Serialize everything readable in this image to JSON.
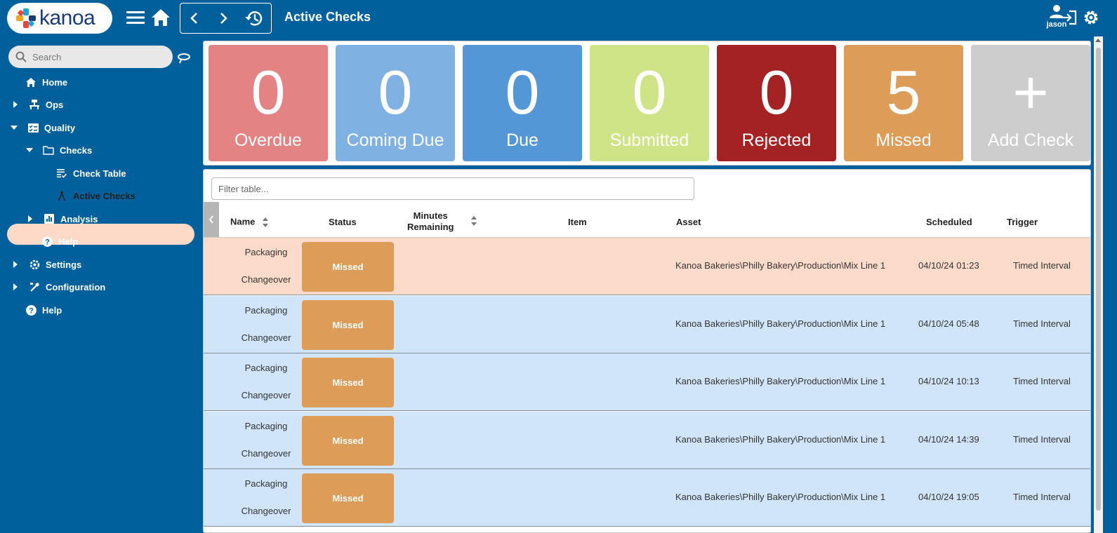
{
  "header": {
    "logo_text": "kanoa",
    "page_title": "Active Checks",
    "user_name": "jason"
  },
  "sidebar": {
    "search_placeholder": "Search",
    "items": [
      {
        "label": "Home",
        "icon": "home-icon"
      },
      {
        "label": "Ops",
        "icon": "ops-icon"
      },
      {
        "label": "Quality",
        "icon": "quality-icon"
      },
      {
        "label": "Checks",
        "icon": "folder-icon"
      },
      {
        "label": "Check Table",
        "icon": "list-check-icon"
      },
      {
        "label": "Active Checks",
        "icon": "compass-icon"
      },
      {
        "label": "Analysis",
        "icon": "analysis-icon"
      },
      {
        "label": "Help",
        "icon": "help-icon"
      },
      {
        "label": "Settings",
        "icon": "gear-icon"
      },
      {
        "label": "Configuration",
        "icon": "tools-icon"
      },
      {
        "label": "Help",
        "icon": "help-icon"
      }
    ]
  },
  "tiles": [
    {
      "count": "0",
      "label": "Overdue",
      "color": "#e38383"
    },
    {
      "count": "0",
      "label": "Coming Due",
      "color": "#7fb1e3"
    },
    {
      "count": "0",
      "label": "Due",
      "color": "#5497d7"
    },
    {
      "count": "0",
      "label": "Submitted",
      "color": "#cfe486"
    },
    {
      "count": "0",
      "label": "Rejected",
      "color": "#a52224"
    },
    {
      "count": "5",
      "label": "Missed",
      "color": "#dd9c58"
    },
    {
      "count": "+",
      "label": "Add Check",
      "color": "#cdcdcd"
    }
  ],
  "table": {
    "filter_placeholder": "Filter table...",
    "columns": {
      "name": "Name",
      "status": "Status",
      "minutes_1": "Minutes",
      "minutes_2": "Remaining",
      "item": "Item",
      "asset": "Asset",
      "scheduled": "Scheduled",
      "trigger": "Trigger"
    },
    "rows": [
      {
        "name_1": "Packaging",
        "name_2": "Changeover",
        "status": "Missed",
        "minutes": "",
        "item": "",
        "asset": "Kanoa Bakeries\\Philly Bakery\\Production\\Mix Line 1",
        "scheduled": "04/10/24 01:23",
        "trigger": "Timed Interval"
      },
      {
        "name_1": "Packaging",
        "name_2": "Changeover",
        "status": "Missed",
        "minutes": "",
        "item": "",
        "asset": "Kanoa Bakeries\\Philly Bakery\\Production\\Mix Line 1",
        "scheduled": "04/10/24 05:48",
        "trigger": "Timed Interval"
      },
      {
        "name_1": "Packaging",
        "name_2": "Changeover",
        "status": "Missed",
        "minutes": "",
        "item": "",
        "asset": "Kanoa Bakeries\\Philly Bakery\\Production\\Mix Line 1",
        "scheduled": "04/10/24 10:13",
        "trigger": "Timed Interval"
      },
      {
        "name_1": "Packaging",
        "name_2": "Changeover",
        "status": "Missed",
        "minutes": "",
        "item": "",
        "asset": "Kanoa Bakeries\\Philly Bakery\\Production\\Mix Line 1",
        "scheduled": "04/10/24 14:39",
        "trigger": "Timed Interval"
      },
      {
        "name_1": "Packaging",
        "name_2": "Changeover",
        "status": "Missed",
        "minutes": "",
        "item": "",
        "asset": "Kanoa Bakeries\\Philly Bakery\\Production\\Mix Line 1",
        "scheduled": "04/10/24 19:05",
        "trigger": "Timed Interval"
      }
    ]
  },
  "colors": {
    "brand": "#00609c",
    "active_nav": "#fdd9c8",
    "row_highlight": "#fddbca",
    "row_normal": "#d0e5fa",
    "missed": "#dd9c58"
  }
}
